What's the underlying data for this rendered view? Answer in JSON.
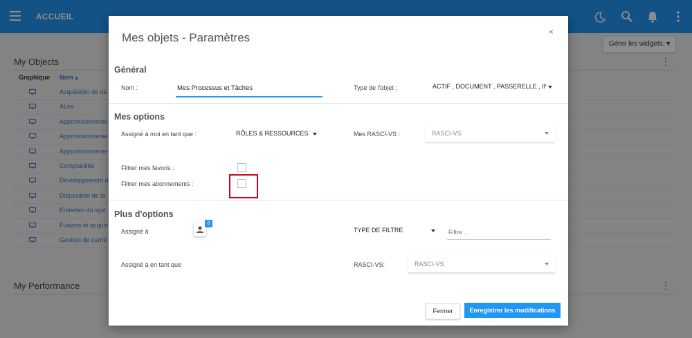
{
  "header": {
    "title": "ACCUEIL"
  },
  "page": {
    "widget_button_label": "Gérer les widgets.",
    "my_objects_title": "My Objects",
    "columns": {
      "graphic": "Graphique",
      "name": "Nom"
    },
    "objects": [
      "Acquisition de de",
      "ALex",
      "Approvisionneme",
      "Approvisionneme",
      "Approvisionneme",
      "Comptabilité",
      "Développement d",
      "Disposition de la",
      "Entretien du syst",
      "Fusions et acquis",
      "Gestion de carriè"
    ],
    "my_performance_title": "My Performance"
  },
  "modal": {
    "title": "Mes objets - Paramètres",
    "close_label": "×",
    "general": {
      "heading": "Général",
      "name_label": "Nom :",
      "name_value": "Mes Processus et Tâches",
      "type_label": "Type de l'objet :",
      "type_value": "ACTIF , DOCUMENT , PASSERELLE , IN"
    },
    "my_options": {
      "heading": "Mes options",
      "assigned_label": "Assigné à moi en tant que :",
      "assigned_value": "RÔLES & RESSOURCES",
      "rasci_label": "Mes RASCI-VS :",
      "rasci_value": "RASCI-VS",
      "favorites_label": "Filtrer mes favoris :",
      "subscriptions_label": "Filtrer mes abonnements :"
    },
    "more_options": {
      "heading": "Plus d'options",
      "assigned_to_label": "Assigné à",
      "assigned_count": "0",
      "filter_type_label": "TYPE DE FILTRE",
      "filter_placeholder": "Filtre ...",
      "assigned_as_label": "Assigné à en tant que",
      "rasci_label": "RASCI-VS:",
      "rasci_value": "RASCI-VS"
    },
    "buttons": {
      "cancel": "Fermer",
      "save": "Enregistrer les modifications"
    }
  },
  "colors": {
    "primary": "#2196f3",
    "highlight": "#d0021b",
    "link": "#3a7cc4"
  }
}
